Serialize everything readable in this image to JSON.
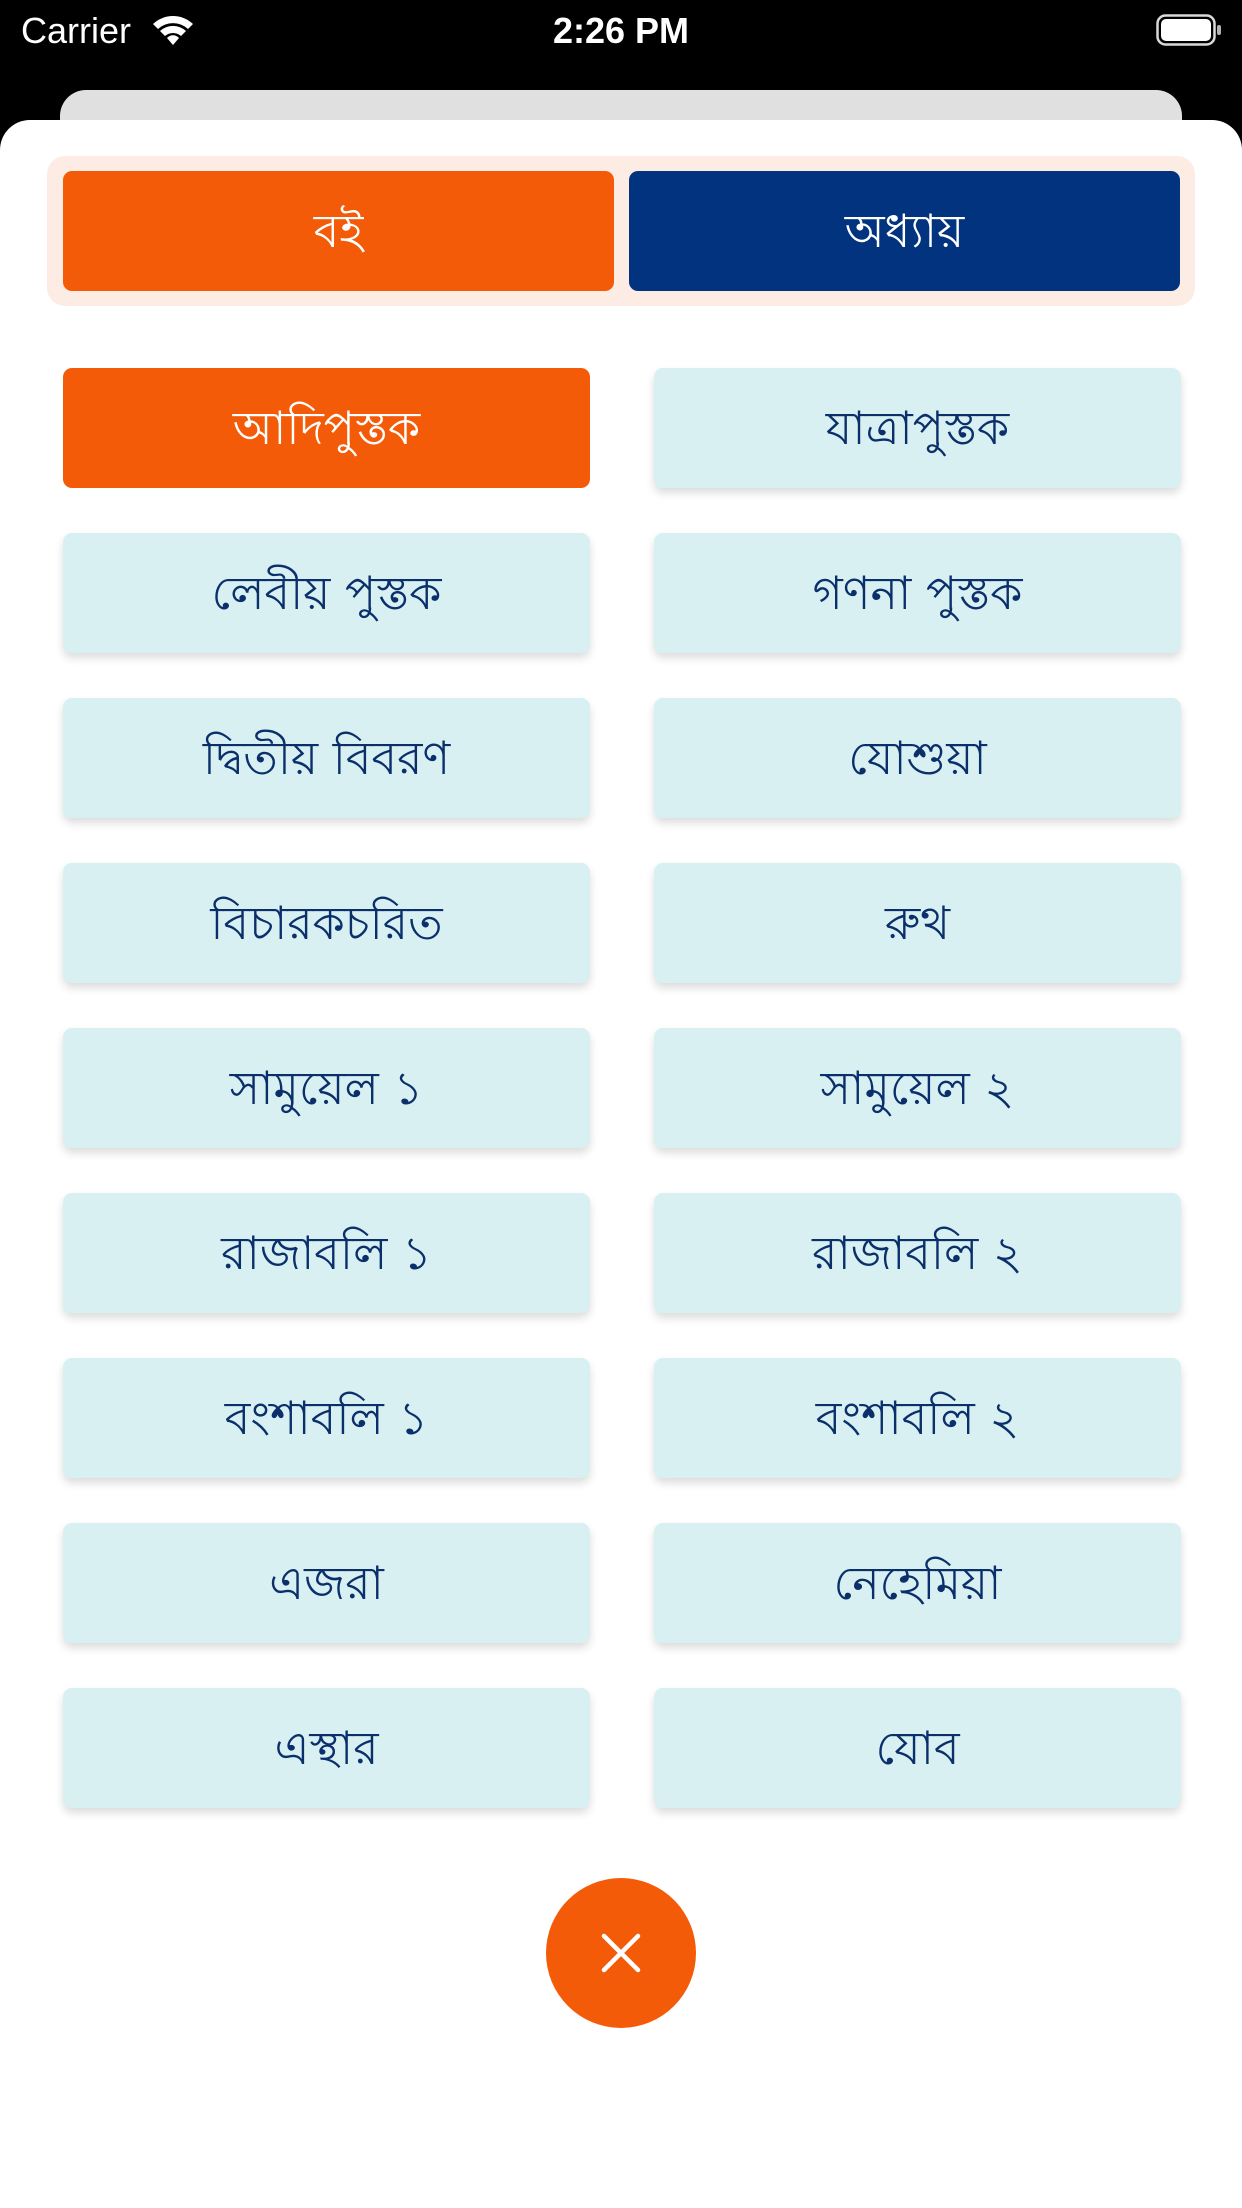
{
  "status_bar": {
    "carrier": "Carrier",
    "time": "2:26 PM",
    "icons": [
      "wifi-icon",
      "battery-icon"
    ]
  },
  "tabs": {
    "book_label": "বই",
    "chapter_label": "অধ্যায়",
    "selected": "book"
  },
  "books": [
    {
      "label": "আদিপুস্তক",
      "selected": true
    },
    {
      "label": "যাত্রাপুস্তক",
      "selected": false
    },
    {
      "label": "লেবীয় পুস্তক",
      "selected": false
    },
    {
      "label": "গণনা পুস্তক",
      "selected": false
    },
    {
      "label": "দ্বিতীয় বিবরণ",
      "selected": false
    },
    {
      "label": "যোশুয়া",
      "selected": false
    },
    {
      "label": "বিচারকচরিত",
      "selected": false
    },
    {
      "label": "রুথ",
      "selected": false
    },
    {
      "label": "সামুয়েল ১",
      "selected": false
    },
    {
      "label": "সামুয়েল ২",
      "selected": false
    },
    {
      "label": "রাজাবলি ১",
      "selected": false
    },
    {
      "label": "রাজাবলি ২",
      "selected": false
    },
    {
      "label": "বংশাবলি ১",
      "selected": false
    },
    {
      "label": "বংশাবলি ২",
      "selected": false
    },
    {
      "label": "এজরা",
      "selected": false
    },
    {
      "label": "নেহেমিয়া",
      "selected": false
    },
    {
      "label": "এস্থার",
      "selected": false
    },
    {
      "label": "যোব",
      "selected": false
    }
  ],
  "close_button": {
    "icon": "close-icon"
  },
  "colors": {
    "accent_orange": "#f45b08",
    "navy": "#02337f",
    "book_bg": "#d8f0f1",
    "book_text": "#0a2f6b",
    "segment_bg": "#fdece4"
  }
}
